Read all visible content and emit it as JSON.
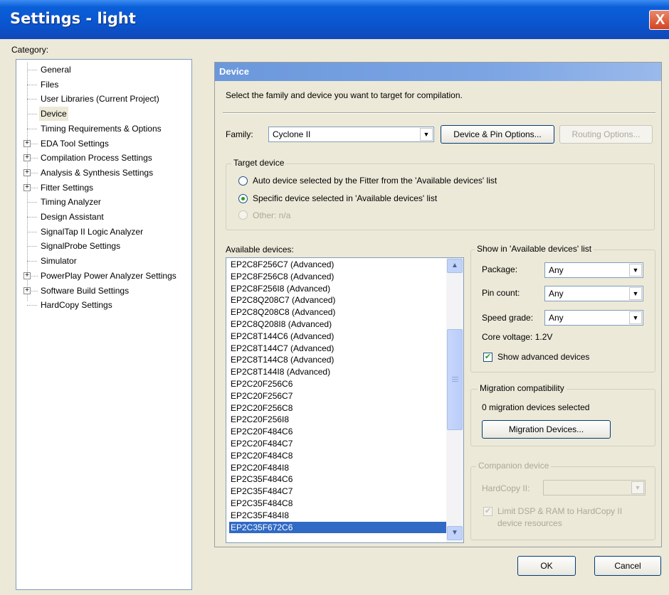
{
  "window": {
    "title": "Settings - light",
    "close_glyph": "X"
  },
  "category_label": "Category:",
  "tree": [
    {
      "label": "General",
      "expandable": false
    },
    {
      "label": "Files",
      "expandable": false
    },
    {
      "label": "User Libraries (Current Project)",
      "expandable": false
    },
    {
      "label": "Device",
      "expandable": false,
      "selected": true
    },
    {
      "label": "Timing Requirements & Options",
      "expandable": false
    },
    {
      "label": "EDA Tool Settings",
      "expandable": true
    },
    {
      "label": "Compilation Process Settings",
      "expandable": true
    },
    {
      "label": "Analysis & Synthesis Settings",
      "expandable": true
    },
    {
      "label": "Fitter Settings",
      "expandable": true
    },
    {
      "label": "Timing Analyzer",
      "expandable": false
    },
    {
      "label": "Design Assistant",
      "expandable": false
    },
    {
      "label": "SignalTap II Logic Analyzer",
      "expandable": false
    },
    {
      "label": "SignalProbe Settings",
      "expandable": false
    },
    {
      "label": "Simulator",
      "expandable": false
    },
    {
      "label": "PowerPlay Power Analyzer Settings",
      "expandable": true
    },
    {
      "label": "Software Build Settings",
      "expandable": true
    },
    {
      "label": "HardCopy Settings",
      "expandable": false
    }
  ],
  "panel": {
    "title": "Device",
    "description": "Select the family and device you want to target for compilation.",
    "family_label": "Family:",
    "family_value": "Cyclone II",
    "device_pin_options": "Device & Pin Options...",
    "routing_options": "Routing Options...",
    "target": {
      "title": "Target device",
      "auto": "Auto device selected by the Fitter from the 'Available devices' list",
      "specific": "Specific device selected in 'Available devices' list",
      "other": "Other:  n/a",
      "selected": "specific"
    },
    "available_label": "Available devices:",
    "devices": [
      "EP2C8F256C7 (Advanced)",
      "EP2C8F256C8 (Advanced)",
      "EP2C8F256I8 (Advanced)",
      "EP2C8Q208C7 (Advanced)",
      "EP2C8Q208C8 (Advanced)",
      "EP2C8Q208I8 (Advanced)",
      "EP2C8T144C6 (Advanced)",
      "EP2C8T144C7 (Advanced)",
      "EP2C8T144C8 (Advanced)",
      "EP2C8T144I8 (Advanced)",
      "EP2C20F256C6",
      "EP2C20F256C7",
      "EP2C20F256C8",
      "EP2C20F256I8",
      "EP2C20F484C6",
      "EP2C20F484C7",
      "EP2C20F484C8",
      "EP2C20F484I8",
      "EP2C35F484C6",
      "EP2C35F484C7",
      "EP2C35F484C8",
      "EP2C35F484I8",
      "EP2C35F672C6"
    ],
    "selected_device": "EP2C35F672C6",
    "show": {
      "title": "Show in 'Available devices' list",
      "package_label": "Package:",
      "package_value": "Any",
      "pin_label": "Pin count:",
      "pin_value": "Any",
      "speed_label": "Speed grade:",
      "speed_value": "Any",
      "core_voltage": "Core voltage:  1.2V",
      "show_advanced": "Show advanced devices",
      "show_advanced_checked": true
    },
    "migration": {
      "title": "Migration compatibility",
      "status": "0 migration devices selected",
      "button": "Migration Devices..."
    },
    "companion": {
      "title": "Companion device",
      "hardcopy_label": "HardCopy II:",
      "limit_line1": "Limit DSP & RAM to HardCopy II",
      "limit_line2": "device resources",
      "limit_checked": true
    }
  },
  "buttons": {
    "ok": "OK",
    "cancel": "Cancel"
  }
}
